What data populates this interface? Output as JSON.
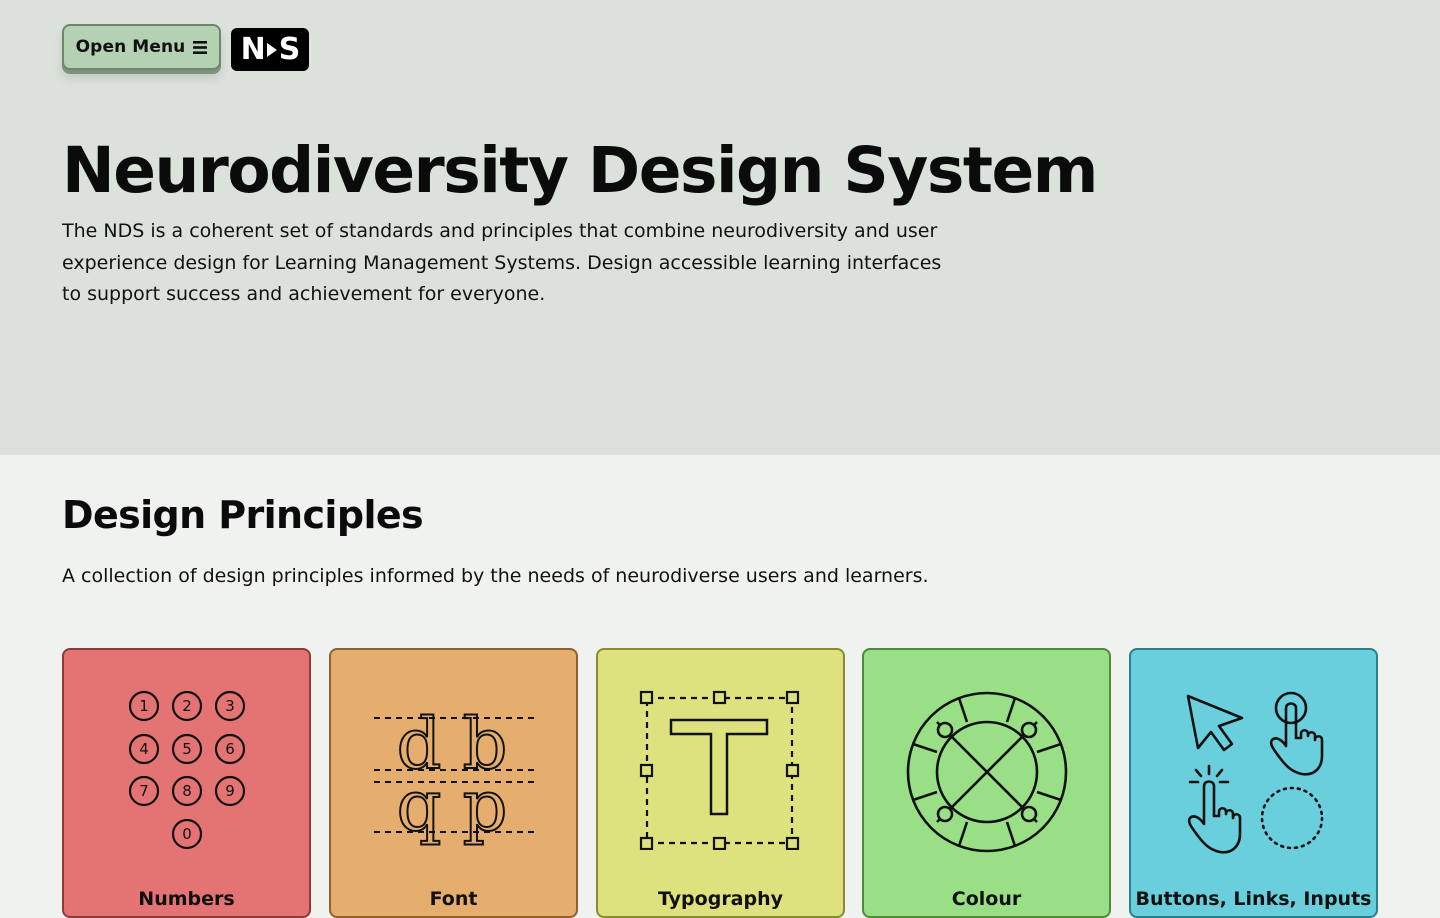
{
  "header": {
    "menu_button_label": "Open Menu",
    "menu_icon": "hamburger-icon",
    "logo_left": "N",
    "logo_right": "S"
  },
  "hero": {
    "title": "Neurodiversity Design System",
    "description": "The NDS is a coherent set of standards and principles that combine neurodiversity and user experience design for Learning Management Systems. Design accessible learning interfaces to support success and achievement for everyone."
  },
  "principles": {
    "title": "Design Principles",
    "description": "A collection of design principles informed by the needs of neurodiverse users and learners.",
    "cards": [
      {
        "label": "Numbers",
        "icon": "numbers-icon",
        "color": "#e47474",
        "digits": [
          "1",
          "2",
          "3",
          "4",
          "5",
          "6",
          "7",
          "8",
          "9",
          "0"
        ]
      },
      {
        "label": "Font",
        "icon": "font-icon",
        "color": "#e5ae6e",
        "glyphs": [
          "d",
          "b",
          "q",
          "p"
        ]
      },
      {
        "label": "Typography",
        "icon": "typography-icon",
        "color": "#dde27e",
        "glyph": "T"
      },
      {
        "label": "Colour",
        "icon": "colour-wheel-icon",
        "color": "#99df85"
      },
      {
        "label": "Buttons, Links, Inputs",
        "icon": "pointer-icons",
        "color": "#6acfdc"
      }
    ]
  }
}
